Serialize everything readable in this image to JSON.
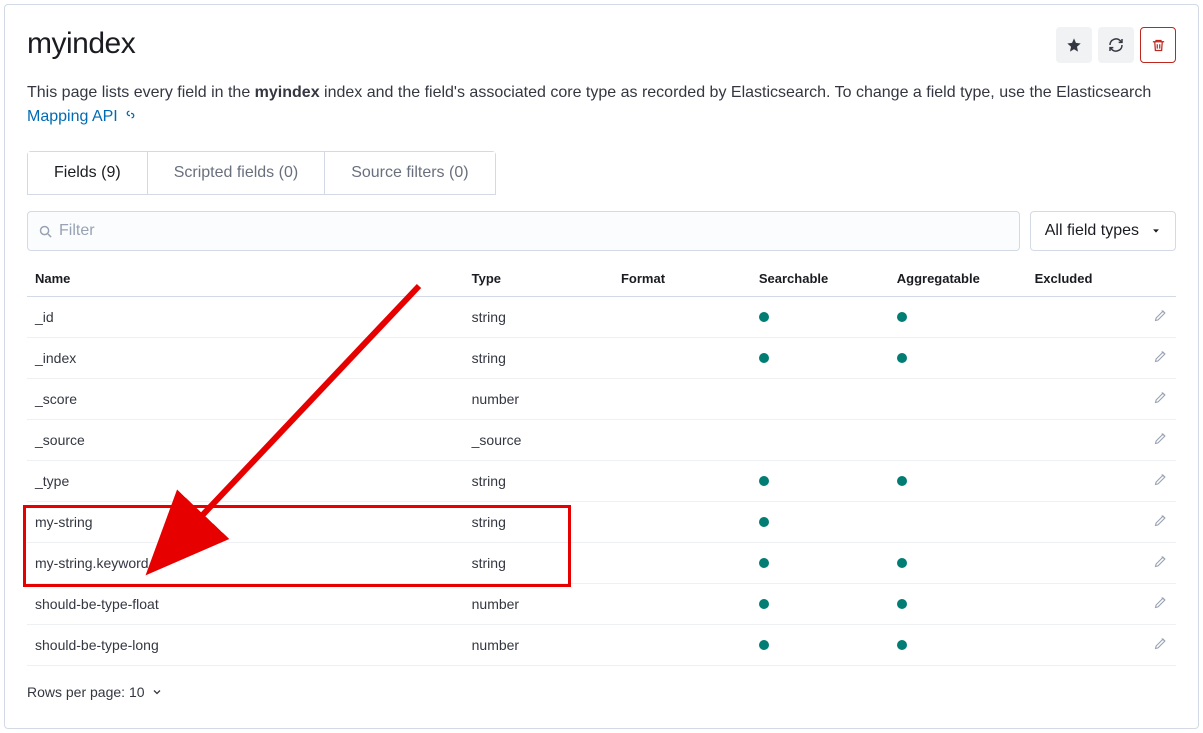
{
  "header": {
    "title": "myindex"
  },
  "description": {
    "pre": "This page lists every field in the ",
    "bold": "myindex",
    "mid": " index and the field's associated core type as recorded by Elasticsearch. To change a field type, use the Elasticsearch ",
    "link": "Mapping API"
  },
  "tabs": {
    "fields": "Fields (9)",
    "scripted": "Scripted fields (0)",
    "source": "Source filters (0)"
  },
  "filter": {
    "placeholder": "Filter",
    "type_selector": "All field types"
  },
  "columns": {
    "name": "Name",
    "type": "Type",
    "format": "Format",
    "searchable": "Searchable",
    "aggregatable": "Aggregatable",
    "excluded": "Excluded"
  },
  "rows": [
    {
      "name": "_id",
      "type": "string",
      "searchable": true,
      "aggregatable": true
    },
    {
      "name": "_index",
      "type": "string",
      "searchable": true,
      "aggregatable": true
    },
    {
      "name": "_score",
      "type": "number",
      "searchable": false,
      "aggregatable": false
    },
    {
      "name": "_source",
      "type": "_source",
      "searchable": false,
      "aggregatable": false
    },
    {
      "name": "_type",
      "type": "string",
      "searchable": true,
      "aggregatable": true
    },
    {
      "name": "my-string",
      "type": "string",
      "searchable": true,
      "aggregatable": false
    },
    {
      "name": "my-string.keyword",
      "type": "string",
      "searchable": true,
      "aggregatable": true
    },
    {
      "name": "should-be-type-float",
      "type": "number",
      "searchable": true,
      "aggregatable": true
    },
    {
      "name": "should-be-type-long",
      "type": "number",
      "searchable": true,
      "aggregatable": true
    }
  ],
  "pager": {
    "label": "Rows per page: 10"
  }
}
